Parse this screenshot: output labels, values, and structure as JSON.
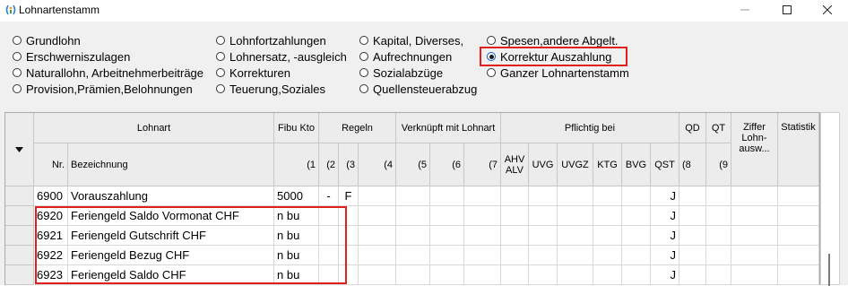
{
  "window": {
    "title": "Lohnartenstamm",
    "icons": {
      "app": "app-icon",
      "minimize": "minimize-icon",
      "maximize": "maximize-icon",
      "close": "close-icon"
    }
  },
  "options": {
    "col1": [
      "Grundlohn",
      "Erschwerniszulagen",
      "Naturallohn, Arbeitnehmerbeiträge",
      "Provision,Prämien,Belohnungen"
    ],
    "col2": [
      "Lohnfortzahlungen",
      "Lohnersatz, -ausgleich",
      "Korrekturen",
      "Teuerung,Soziales"
    ],
    "col3": [
      "Kapital, Diverses,",
      "Aufrechnungen",
      "Sozialabzüge",
      "Quellensteuerabzug"
    ],
    "col4": [
      "Spesen,andere Abgelt.",
      "Korrektur Auszahlung",
      "Ganzer Lohnartenstamm"
    ],
    "selected": "Korrektur Auszahlung"
  },
  "table": {
    "header": {
      "lohnart": "Lohnart",
      "fibu": "Fibu Kto",
      "regeln": "Regeln",
      "verknuepft": "Verknüpft mit Lohnart",
      "pflichtig": "Pflichtig bei",
      "qd": "QD",
      "qt": "QT",
      "ziffer": "Ziffer Lohn- ausw...",
      "statistik": "Statistik",
      "nr": "Nr.",
      "bezeichnung": "Bezeichnung",
      "c1": "(1",
      "c2": "(2",
      "c3": "(3",
      "c4": "(4",
      "c5": "(5",
      "c6": "(6",
      "c7": "(7",
      "ahv": "AHV ALV",
      "uvg": "UVG",
      "uvgz": "UVGZ",
      "ktg": "KTG",
      "bvg": "BVG",
      "qst": "QST",
      "c8": "(8",
      "c9": "(9"
    },
    "sort_icon": "sort-down-icon",
    "rows": [
      {
        "nr": "6900",
        "bez": "Vorauszahlung",
        "fibu": "5000",
        "r2": "-",
        "r3": "F",
        "qst": "J"
      },
      {
        "nr": "6920",
        "bez": "Feriengeld Saldo Vormonat CHF",
        "fibu": "n bu",
        "r2": "",
        "r3": "",
        "qst": "J"
      },
      {
        "nr": "6921",
        "bez": "Feriengeld Gutschrift CHF",
        "fibu": "n bu",
        "r2": "",
        "r3": "",
        "qst": "J"
      },
      {
        "nr": "6922",
        "bez": "Feriengeld Bezug CHF",
        "fibu": "n bu",
        "r2": "",
        "r3": "",
        "qst": "J"
      },
      {
        "nr": "6923",
        "bez": "Feriengeld Saldo CHF",
        "fibu": "n bu",
        "r2": "",
        "r3": "",
        "qst": "J"
      }
    ]
  },
  "highlight_color": "#e0201c"
}
